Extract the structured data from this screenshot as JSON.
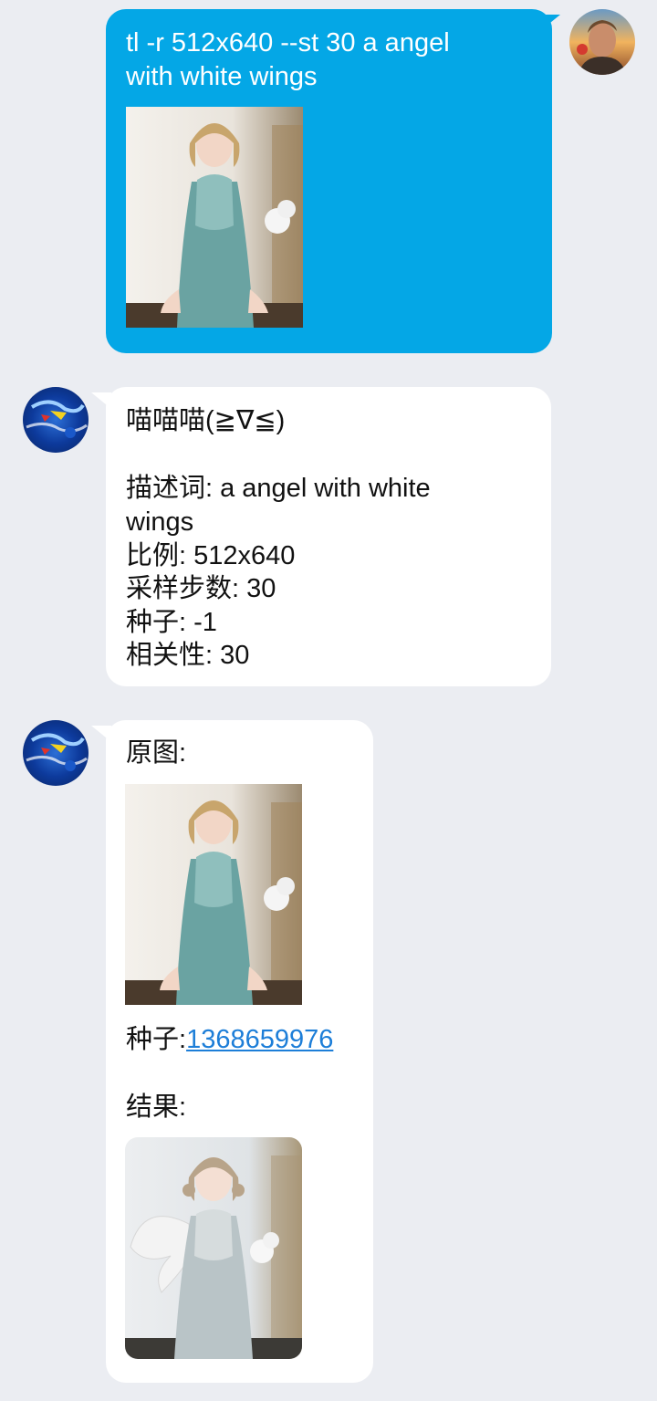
{
  "messages": {
    "user_command": {
      "line1": "tl -r 512x640 --st 30 a angel",
      "line2": "with white wings"
    },
    "bot_params": {
      "greeting": "喵喵喵(≧∇≦)",
      "prompt_line1": "描述词: a angel with white",
      "prompt_line2": "wings",
      "ratio": "比例: 512x640",
      "steps": "采样步数: 30",
      "seed": "种子: -1",
      "relevance": "相关性: 30"
    },
    "bot_result": {
      "original_label": "原图:",
      "seed_label": "种子:",
      "seed_value": "1368659976",
      "result_label": "结果:"
    }
  },
  "icons": {
    "user_avatar": "user-avatar-photo",
    "bot_avatar": "bot-avatar-blue-painting"
  },
  "colors": {
    "background": "#ebedf2",
    "user_bubble": "#04a7e6",
    "bot_bubble": "#ffffff",
    "link": "#1d7ed8"
  }
}
